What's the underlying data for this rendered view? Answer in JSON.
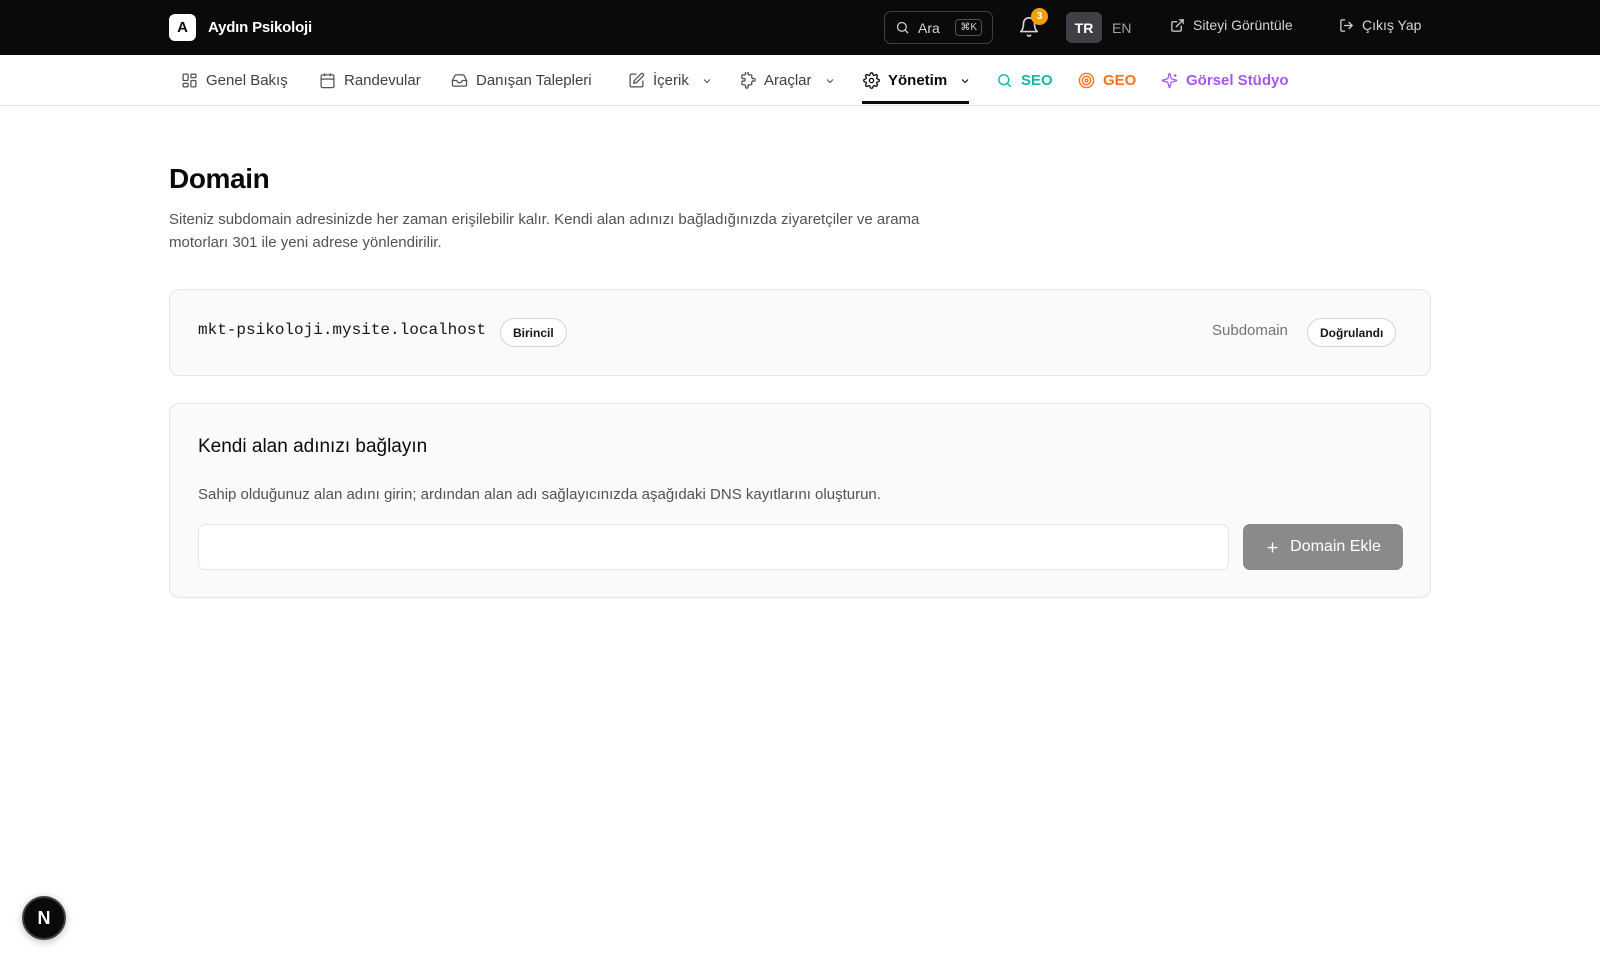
{
  "brand": {
    "logo_letter": "A",
    "name": "Aydın Psikoloji"
  },
  "topbar": {
    "search_label": "Ara",
    "search_shortcut": "⌘K",
    "notification_count": "3",
    "lang_active": "TR",
    "lang_other": "EN",
    "view_site": "Siteyi Görüntüle",
    "logout": "Çıkış Yap"
  },
  "nav": {
    "items": [
      {
        "label": "Genel Bakış",
        "icon": "dashboard-icon"
      },
      {
        "label": "Randevular",
        "icon": "calendar-icon"
      },
      {
        "label": "Danışan Talepleri",
        "icon": "inbox-icon"
      },
      {
        "label": "İçerik",
        "icon": "edit-icon",
        "dropdown": true
      },
      {
        "label": "Araçlar",
        "icon": "puzzle-icon",
        "dropdown": true
      },
      {
        "label": "Yönetim",
        "icon": "gear-icon",
        "dropdown": true,
        "active": true
      },
      {
        "label": "SEO",
        "icon": "search-icon",
        "color": "#14b8a6"
      },
      {
        "label": "GEO",
        "icon": "target-icon",
        "color": "#f97316"
      },
      {
        "label": "Görsel Stüdyo",
        "icon": "sparkles-icon",
        "color": "#a855f7"
      }
    ]
  },
  "main": {
    "title": "Domain",
    "description": "Siteniz subdomain adresinizde her zaman erişilebilir kalır. Kendi alan adınızı bağladığınızda ziyaretçiler ve arama motorları 301 ile yeni adrese yönlendirilir.",
    "current_domain": {
      "host": "mkt-psikoloji.mysite.localhost",
      "primary_badge": "Birincil",
      "type_label": "Subdomain",
      "status_badge": "Doğrulandı"
    },
    "connect": {
      "title": "Kendi alan adınızı bağlayın",
      "description": "Sahip olduğunuz alan adını girin; ardından alan adı sağlayıcınızda aşağıdaki DNS kayıtlarını oluşturun.",
      "input_value": "",
      "button_label": "Domain Ekle"
    }
  },
  "dev_badge": "N"
}
